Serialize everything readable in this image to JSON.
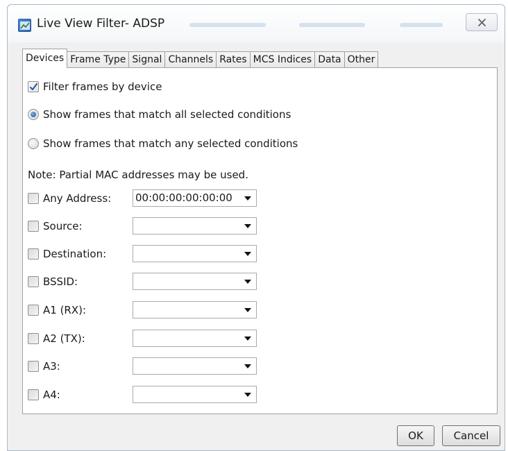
{
  "window": {
    "title": "Live View Filter- ADSP",
    "icon": "app-window-icon"
  },
  "tabs": [
    {
      "label": "Devices",
      "active": true
    },
    {
      "label": "Frame Type",
      "active": false
    },
    {
      "label": "Signal",
      "active": false
    },
    {
      "label": "Channels",
      "active": false
    },
    {
      "label": "Rates",
      "active": false
    },
    {
      "label": "MCS Indices",
      "active": false
    },
    {
      "label": "Data",
      "active": false
    },
    {
      "label": "Other",
      "active": false
    }
  ],
  "devices": {
    "filter_by_device": {
      "label": "Filter frames by device",
      "checked": true
    },
    "match_all": {
      "label": "Show frames that match all selected conditions",
      "selected": true
    },
    "match_any": {
      "label": "Show frames that match any selected conditions",
      "selected": false
    },
    "note": "Note: Partial MAC addresses may be used.",
    "fields": [
      {
        "label": "Any Address:",
        "value": "00:00:00:00:00:00",
        "checked": false
      },
      {
        "label": "Source:",
        "value": "",
        "checked": false
      },
      {
        "label": "Destination:",
        "value": "",
        "checked": false
      },
      {
        "label": "BSSID:",
        "value": "",
        "checked": false
      },
      {
        "label": "A1 (RX):",
        "value": "",
        "checked": false
      },
      {
        "label": "A2 (TX):",
        "value": "",
        "checked": false
      },
      {
        "label": "A3:",
        "value": "",
        "checked": false
      },
      {
        "label": "A4:",
        "value": "",
        "checked": false
      }
    ]
  },
  "buttons": {
    "ok": "OK",
    "cancel": "Cancel"
  },
  "colors": {
    "accent": "#2a5ea8",
    "window_bg": "#f0f0f0"
  }
}
